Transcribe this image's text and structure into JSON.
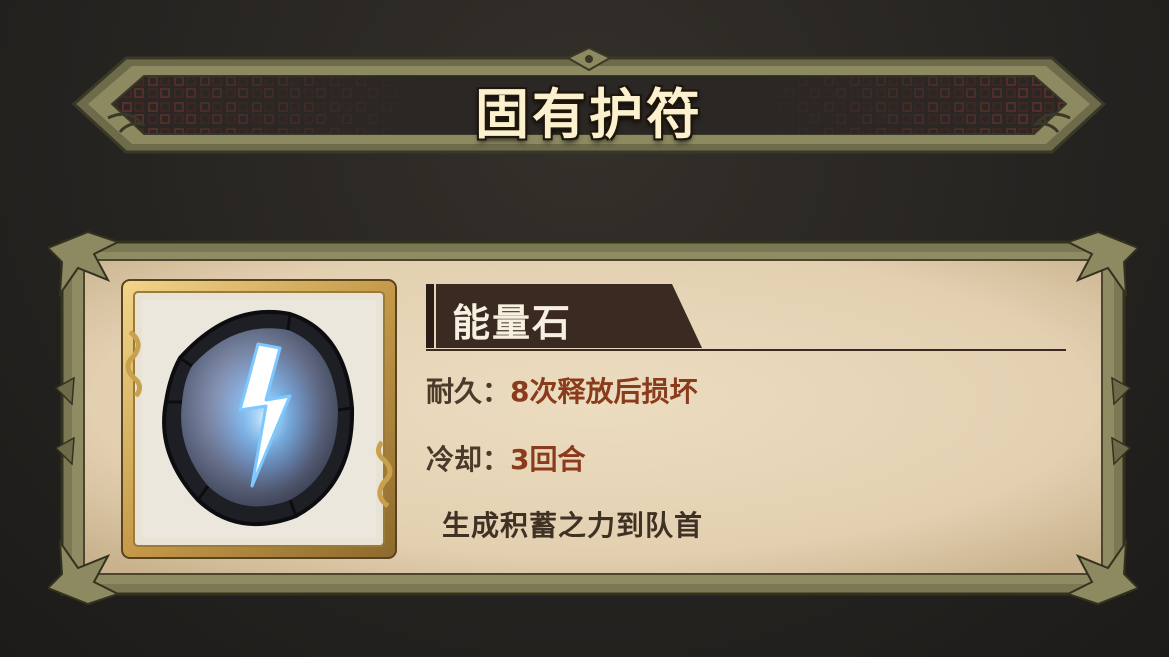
{
  "title": "固有护符",
  "item": {
    "name": "能量石",
    "icon": "energy-stone-lightning-icon",
    "durability": {
      "label": "耐久：",
      "value": "8次释放后损坏"
    },
    "cooldown": {
      "label": "冷却：",
      "value": "3回合"
    },
    "effect": "生成积蓄之力到队首"
  },
  "colors": {
    "background": "#262421",
    "card_parchment": "#e7d6ba",
    "frame_olive": "#8d8a62",
    "title_text": "#fbf1cf",
    "value_text": "#8a3b1c",
    "label_text": "#4a3a2a",
    "name_plate": "#3a2a22",
    "lightning": "#8fd0ff"
  }
}
